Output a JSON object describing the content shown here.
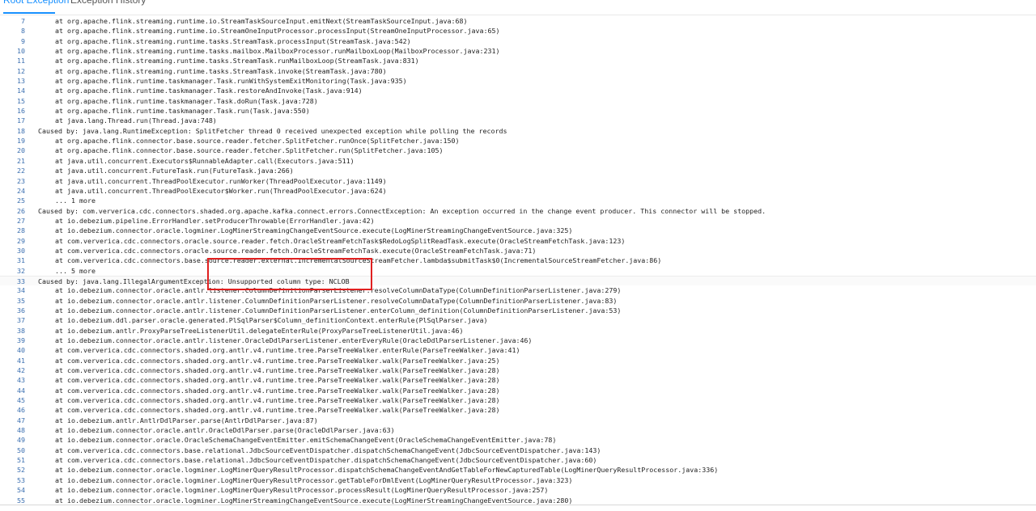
{
  "tabs": [
    {
      "label": "Root Exception",
      "active": true
    },
    {
      "label": "Exception History",
      "active": false
    }
  ],
  "trace": [
    {
      "n": "7",
      "t": "at org.apache.flink.streaming.runtime.io.StreamTaskSourceInput.emitNext(StreamTaskSourceInput.java:68)"
    },
    {
      "n": "8",
      "t": "at org.apache.flink.streaming.runtime.io.StreamOneInputProcessor.processInput(StreamOneInputProcessor.java:65)"
    },
    {
      "n": "9",
      "t": "at org.apache.flink.streaming.runtime.tasks.StreamTask.processInput(StreamTask.java:542)"
    },
    {
      "n": "10",
      "t": "at org.apache.flink.streaming.runtime.tasks.mailbox.MailboxProcessor.runMailboxLoop(MailboxProcessor.java:231)"
    },
    {
      "n": "11",
      "t": "at org.apache.flink.streaming.runtime.tasks.StreamTask.runMailboxLoop(StreamTask.java:831)"
    },
    {
      "n": "12",
      "t": "at org.apache.flink.streaming.runtime.tasks.StreamTask.invoke(StreamTask.java:780)"
    },
    {
      "n": "13",
      "t": "at org.apache.flink.runtime.taskmanager.Task.runWithSystemExitMonitoring(Task.java:935)"
    },
    {
      "n": "14",
      "t": "at org.apache.flink.runtime.taskmanager.Task.restoreAndInvoke(Task.java:914)"
    },
    {
      "n": "15",
      "t": "at org.apache.flink.runtime.taskmanager.Task.doRun(Task.java:728)"
    },
    {
      "n": "16",
      "t": "at org.apache.flink.runtime.taskmanager.Task.run(Task.java:550)"
    },
    {
      "n": "17",
      "t": "at java.lang.Thread.run(Thread.java:748)"
    },
    {
      "n": "18",
      "t": "Caused by: java.lang.RuntimeException: SplitFetcher thread 0 received unexpected exception while polling the records",
      "caused": true
    },
    {
      "n": "19",
      "t": "at org.apache.flink.connector.base.source.reader.fetcher.SplitFetcher.runOnce(SplitFetcher.java:150)"
    },
    {
      "n": "20",
      "t": "at org.apache.flink.connector.base.source.reader.fetcher.SplitFetcher.run(SplitFetcher.java:105)"
    },
    {
      "n": "21",
      "t": "at java.util.concurrent.Executors$RunnableAdapter.call(Executors.java:511)"
    },
    {
      "n": "22",
      "t": "at java.util.concurrent.FutureTask.run(FutureTask.java:266)"
    },
    {
      "n": "23",
      "t": "at java.util.concurrent.ThreadPoolExecutor.runWorker(ThreadPoolExecutor.java:1149)"
    },
    {
      "n": "24",
      "t": "at java.util.concurrent.ThreadPoolExecutor$Worker.run(ThreadPoolExecutor.java:624)"
    },
    {
      "n": "25",
      "t": "... 1 more"
    },
    {
      "n": "26",
      "t": "Caused by: com.ververica.cdc.connectors.shaded.org.apache.kafka.connect.errors.ConnectException: An exception occurred in the change event producer. This connector will be stopped.",
      "caused": true
    },
    {
      "n": "27",
      "t": "at io.debezium.pipeline.ErrorHandler.setProducerThrowable(ErrorHandler.java:42)"
    },
    {
      "n": "28",
      "t": "at io.debezium.connector.oracle.logminer.LogMinerStreamingChangeEventSource.execute(LogMinerStreamingChangeEventSource.java:325)"
    },
    {
      "n": "29",
      "t": "at com.ververica.cdc.connectors.oracle.source.reader.fetch.OracleStreamFetchTask$RedoLogSplitReadTask.execute(OracleStreamFetchTask.java:123)"
    },
    {
      "n": "30",
      "t": "at com.ververica.cdc.connectors.oracle.source.reader.fetch.OracleStreamFetchTask.execute(OracleStreamFetchTask.java:71)"
    },
    {
      "n": "31",
      "t": "at com.ververica.cdc.connectors.base.source.reader.external.IncrementalSourceStreamFetcher.lambda$submitTask$0(IncrementalSourceStreamFetcher.java:86)"
    },
    {
      "n": "32",
      "t": "... 5 more"
    },
    {
      "n": "33",
      "t": "Caused by: java.lang.IllegalArgumentException: Unsupported column type: NCLOB",
      "caused": true,
      "hl": true
    },
    {
      "n": "34",
      "t": "at io.debezium.connector.oracle.antlr.listener.ColumnDefinitionParserListener.resolveColumnDataType(ColumnDefinitionParserListener.java:279)"
    },
    {
      "n": "35",
      "t": "at io.debezium.connector.oracle.antlr.listener.ColumnDefinitionParserListener.resolveColumnDataType(ColumnDefinitionParserListener.java:83)"
    },
    {
      "n": "36",
      "t": "at io.debezium.connector.oracle.antlr.listener.ColumnDefinitionParserListener.enterColumn_definition(ColumnDefinitionParserListener.java:53)"
    },
    {
      "n": "37",
      "t": "at io.debezium.ddl.parser.oracle.generated.PlSqlParser$Column_definitionContext.enterRule(PlSqlParser.java)"
    },
    {
      "n": "38",
      "t": "at io.debezium.antlr.ProxyParseTreeListenerUtil.delegateEnterRule(ProxyParseTreeListenerUtil.java:46)"
    },
    {
      "n": "39",
      "t": "at io.debezium.connector.oracle.antlr.listener.OracleDdlParserListener.enterEveryRule(OracleDdlParserListener.java:46)"
    },
    {
      "n": "40",
      "t": "at com.ververica.cdc.connectors.shaded.org.antlr.v4.runtime.tree.ParseTreeWalker.enterRule(ParseTreeWalker.java:41)"
    },
    {
      "n": "41",
      "t": "at com.ververica.cdc.connectors.shaded.org.antlr.v4.runtime.tree.ParseTreeWalker.walk(ParseTreeWalker.java:25)"
    },
    {
      "n": "42",
      "t": "at com.ververica.cdc.connectors.shaded.org.antlr.v4.runtime.tree.ParseTreeWalker.walk(ParseTreeWalker.java:28)"
    },
    {
      "n": "43",
      "t": "at com.ververica.cdc.connectors.shaded.org.antlr.v4.runtime.tree.ParseTreeWalker.walk(ParseTreeWalker.java:28)"
    },
    {
      "n": "44",
      "t": "at com.ververica.cdc.connectors.shaded.org.antlr.v4.runtime.tree.ParseTreeWalker.walk(ParseTreeWalker.java:28)"
    },
    {
      "n": "45",
      "t": "at com.ververica.cdc.connectors.shaded.org.antlr.v4.runtime.tree.ParseTreeWalker.walk(ParseTreeWalker.java:28)"
    },
    {
      "n": "46",
      "t": "at com.ververica.cdc.connectors.shaded.org.antlr.v4.runtime.tree.ParseTreeWalker.walk(ParseTreeWalker.java:28)"
    },
    {
      "n": "47",
      "t": "at io.debezium.antlr.AntlrDdlParser.parse(AntlrDdlParser.java:87)"
    },
    {
      "n": "48",
      "t": "at io.debezium.connector.oracle.antlr.OracleDdlParser.parse(OracleDdlParser.java:63)"
    },
    {
      "n": "49",
      "t": "at io.debezium.connector.oracle.OracleSchemaChangeEventEmitter.emitSchemaChangeEvent(OracleSchemaChangeEventEmitter.java:78)"
    },
    {
      "n": "50",
      "t": "at com.ververica.cdc.connectors.base.relational.JdbcSourceEventDispatcher.dispatchSchemaChangeEvent(JdbcSourceEventDispatcher.java:143)"
    },
    {
      "n": "51",
      "t": "at com.ververica.cdc.connectors.base.relational.JdbcSourceEventDispatcher.dispatchSchemaChangeEvent(JdbcSourceEventDispatcher.java:60)"
    },
    {
      "n": "52",
      "t": "at io.debezium.connector.oracle.logminer.LogMinerQueryResultProcessor.dispatchSchemaChangeEventAndGetTableForNewCapturedTable(LogMinerQueryResultProcessor.java:336)"
    },
    {
      "n": "53",
      "t": "at io.debezium.connector.oracle.logminer.LogMinerQueryResultProcessor.getTableForDmlEvent(LogMinerQueryResultProcessor.java:323)"
    },
    {
      "n": "54",
      "t": "at io.debezium.connector.oracle.logminer.LogMinerQueryResultProcessor.processResult(LogMinerQueryResultProcessor.java:257)"
    },
    {
      "n": "55",
      "t": "at io.debezium.connector.oracle.logminer.LogMinerStreamingChangeEventSource.execute(LogMinerStreamingChangeEventSource.java:280)"
    }
  ],
  "colors": {
    "accent": "#1890ff",
    "line_number": "#3b6fb0",
    "keyword": "#1a2fd0",
    "class_ref": "#2b7fa8",
    "highlight_box": "#e02020"
  }
}
